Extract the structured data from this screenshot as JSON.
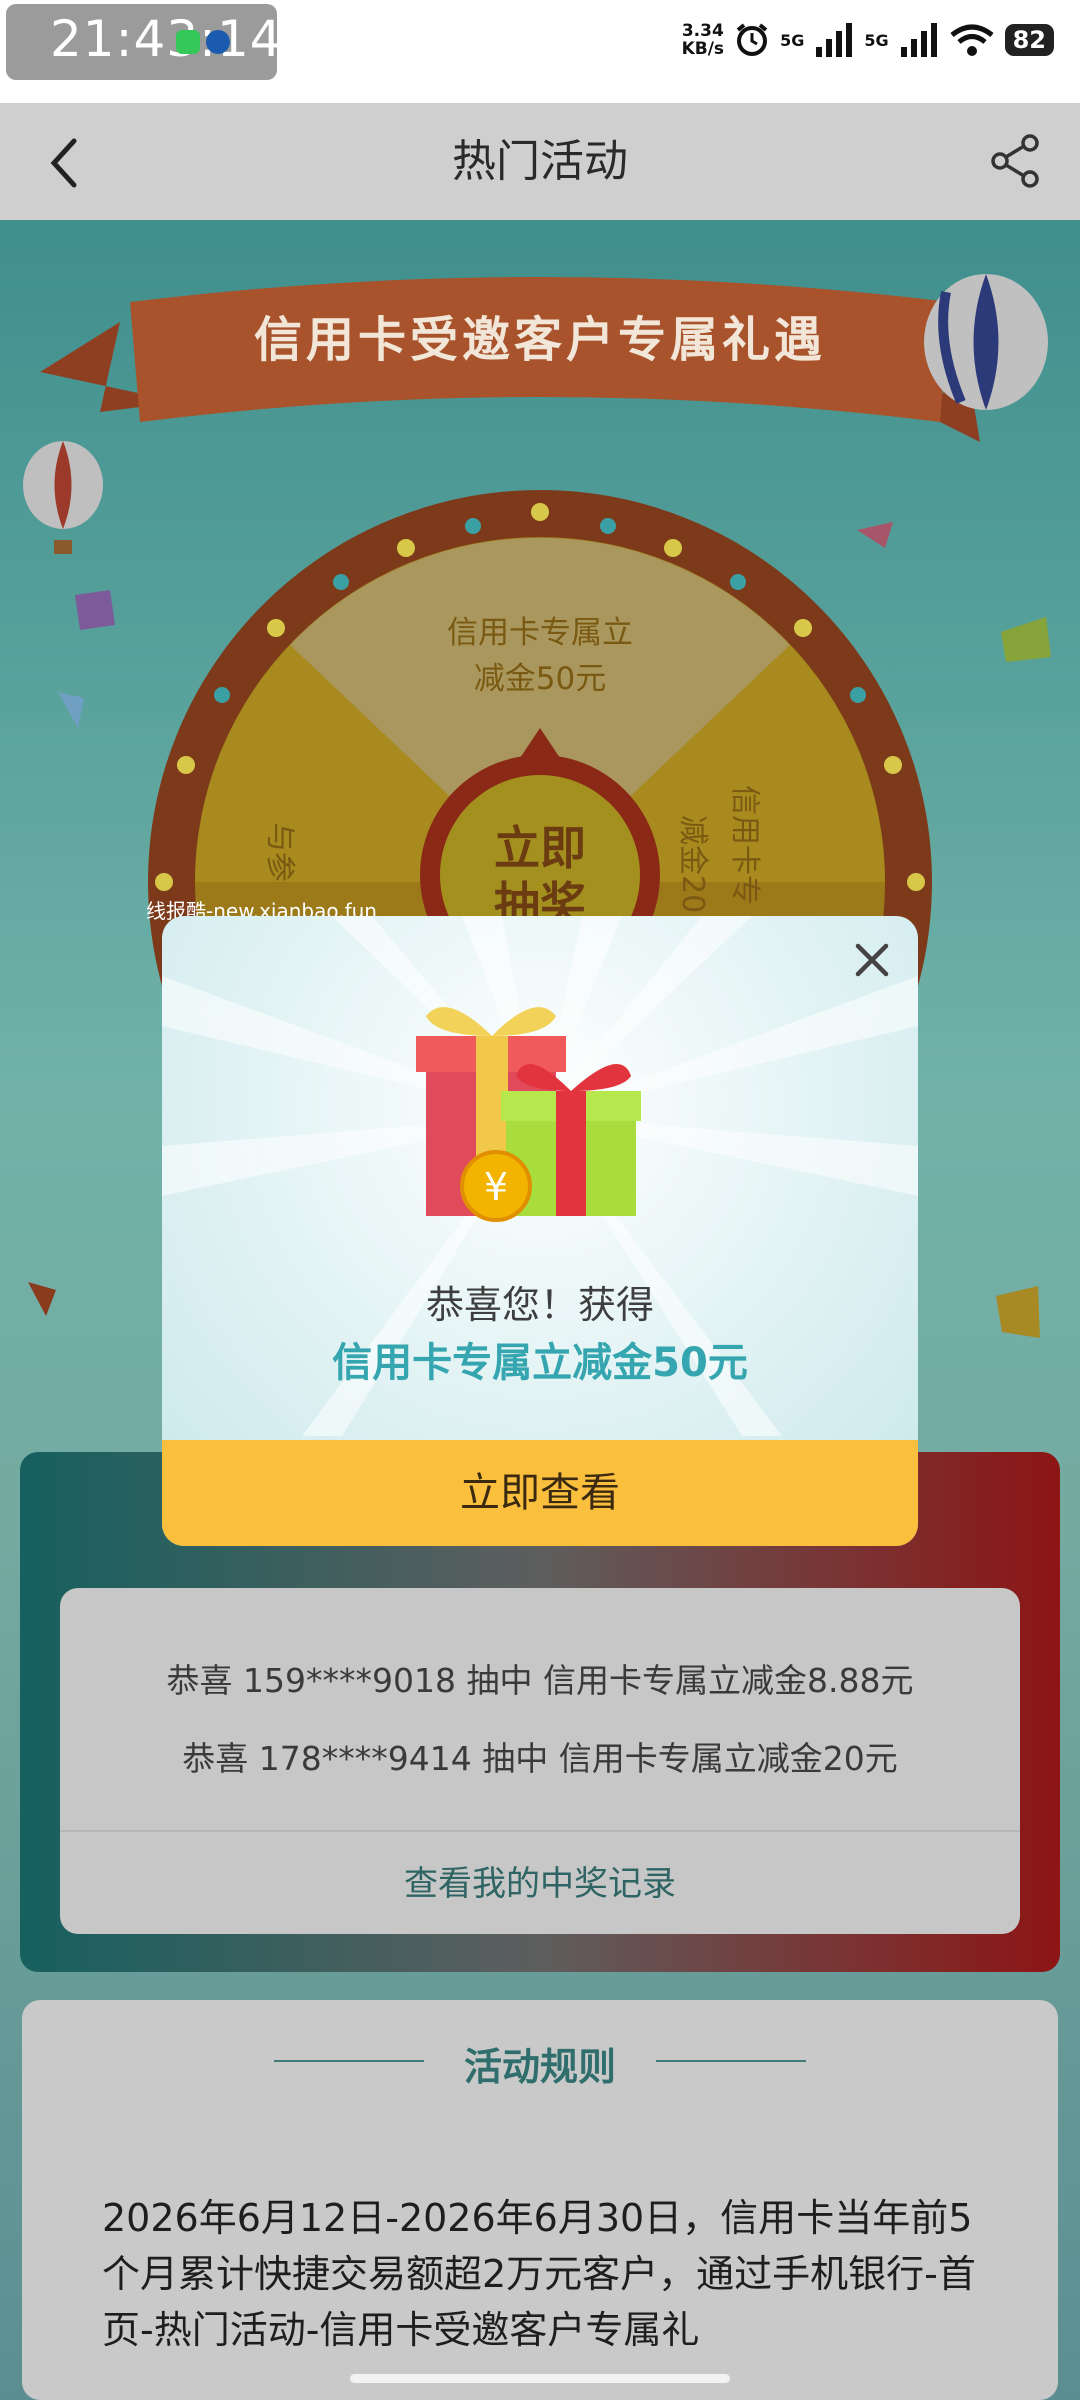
{
  "status_bar": {
    "time": "21:43:14",
    "net_speed_value": "3.34",
    "net_speed_unit": "KB/s",
    "sim1": "5G",
    "sim2": "5G",
    "battery": "82"
  },
  "nav": {
    "title": "热门活动",
    "back_icon": "chevron-left-icon",
    "share_icon": "share-icon"
  },
  "banner": {
    "title": "信用卡受邀客户专属礼遇"
  },
  "wheel": {
    "top_segment_label_line1": "信用卡专属立",
    "top_segment_label_line2": "减金50元",
    "right_segment_label": "信用卡专",
    "right_segment_label2": "减金20",
    "left_segment_label": "与参",
    "go_button_line1": "立即",
    "go_button_line2": "抽奖"
  },
  "watermark": "线报酷-new.xianbao.fun",
  "modal": {
    "message_line1": "恭喜您！获得",
    "message_line2": "信用卡专属立减金50元",
    "button": "立即查看",
    "close_icon": "close-icon",
    "gift_icon": "gift-box-icon"
  },
  "winners": {
    "items": [
      "恭喜 159****9018 抽中 信用卡专属立减金8.88元",
      "恭喜 178****9414 抽中 信用卡专属立减金20元"
    ],
    "records_link": "查看我的中奖记录"
  },
  "rules": {
    "title": "活动规则",
    "text": "2026年6月12日-2026年6月30日，信用卡当年前5个月累计快捷交易额超2万元客户，通过手机银行-首页-热门活动-信用卡受邀客户专属礼"
  },
  "colors": {
    "accent": "#35a6b0",
    "button": "#fbbf3e",
    "overlay_teal": "#4f8d8c"
  }
}
